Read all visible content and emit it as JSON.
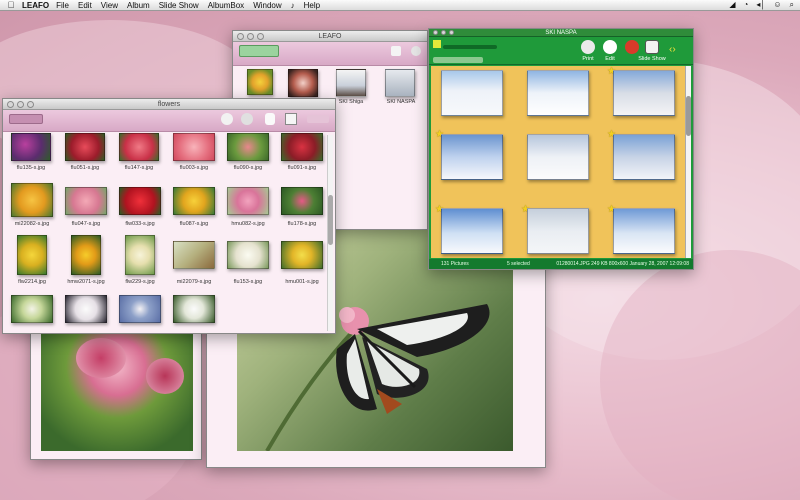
{
  "menubar": {
    "apple_icon": "apple-icon",
    "app_name": "LEAFO",
    "items": [
      "File",
      "Edit",
      "View",
      "Album",
      "Slide Show",
      "AlbumBox",
      "Window",
      "♪",
      "Help"
    ],
    "status_icons": [
      "◢",
      "◔",
      "◂│",
      "☺",
      "⌕"
    ]
  },
  "leafo_window": {
    "title": "LEAFO",
    "items": [
      {
        "caption": ""
      },
      {
        "caption": ""
      },
      {
        "caption": "SKI Shiga"
      },
      {
        "caption": "SKI NASPA"
      }
    ]
  },
  "flowers_window": {
    "title": "flowers",
    "items": [
      {
        "caption": "flu135-s.jpg"
      },
      {
        "caption": "flu051-s.jpg"
      },
      {
        "caption": "flu147-s.jpg"
      },
      {
        "caption": "flu003-s.jpg"
      },
      {
        "caption": "flu090-s.jpg"
      },
      {
        "caption": "flu091-s.jpg"
      },
      {
        "caption": "mi22082-s.jpg"
      },
      {
        "caption": "flu047-s.jpg"
      },
      {
        "caption": "flw033-s.jpg"
      },
      {
        "caption": "flu087-s.jpg"
      },
      {
        "caption": "hmu082-s.jpg"
      },
      {
        "caption": "flu178-s.jpg"
      },
      {
        "caption": "flw2214.jpg"
      },
      {
        "caption": "hmw2071-s.jpg"
      },
      {
        "caption": "flw229-s.jpg"
      },
      {
        "caption": "mi22079-s.jpg"
      },
      {
        "caption": "flu153-s.jpg"
      },
      {
        "caption": "hmu001-s.jpg"
      },
      {
        "caption": ""
      },
      {
        "caption": ""
      },
      {
        "caption": ""
      },
      {
        "caption": ""
      }
    ]
  },
  "ski_window": {
    "title": "SKI NASPA",
    "toolbar": [
      "Print",
      "Edit",
      "Slide Show"
    ],
    "footer_left": "131 Pictures",
    "footer_mid": "5 selected",
    "footer_right": "01280014.JPG  249 KB  800x600  January 28, 2007  12:09:08"
  },
  "colors": {
    "accent_green": "#1f9a3a",
    "ski_background": "#f0c35a",
    "pink_toolbar": "#d8a9c6",
    "desktop_pink": "#e9bfcd"
  }
}
